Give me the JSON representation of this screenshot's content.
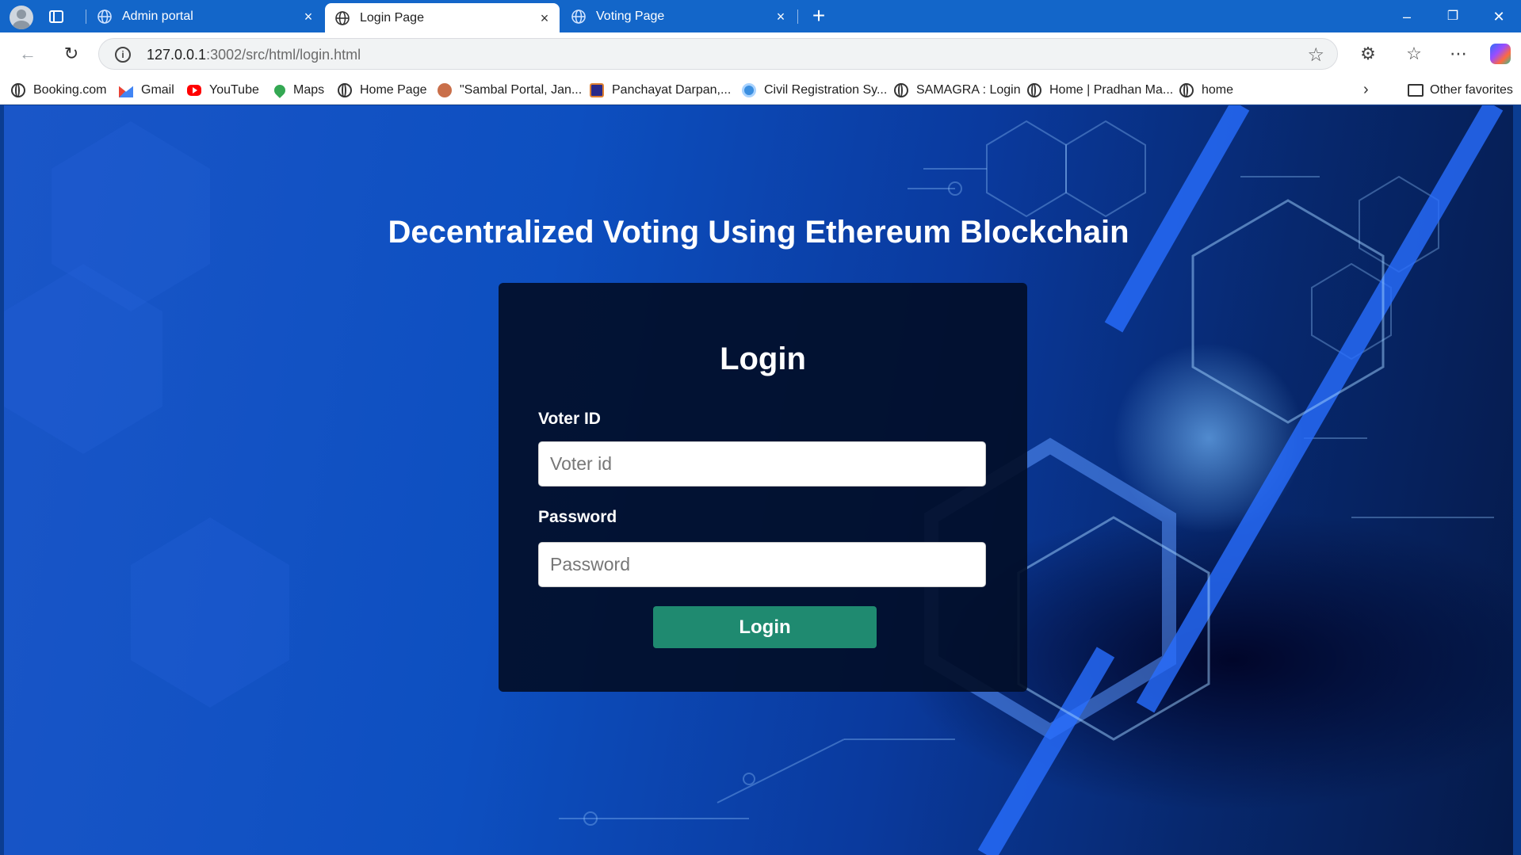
{
  "browser": {
    "tabs": [
      {
        "label": "Admin portal",
        "active": false
      },
      {
        "label": "Login Page",
        "active": true
      },
      {
        "label": "Voting Page",
        "active": false
      }
    ],
    "address": {
      "host": "127.0.0.1",
      "path": ":3002/src/html/login.html"
    },
    "favorites": [
      {
        "label": "Booking.com",
        "icon": "globe-icon"
      },
      {
        "label": "Gmail",
        "icon": "gmail-icon"
      },
      {
        "label": "YouTube",
        "icon": "youtube-icon"
      },
      {
        "label": "Maps",
        "icon": "maps-icon"
      },
      {
        "label": "Home Page",
        "icon": "globe-icon"
      },
      {
        "label": "\"Sambal Portal, Jan...",
        "icon": "sambal-icon"
      },
      {
        "label": "Panchayat Darpan,...",
        "icon": "panchayat-icon"
      },
      {
        "label": "Civil Registration Sy...",
        "icon": "civil-icon"
      },
      {
        "label": "SAMAGRA : Login",
        "icon": "globe-icon"
      },
      {
        "label": "Home | Pradhan Ma...",
        "icon": "globe-icon"
      },
      {
        "label": "home",
        "icon": "globe-icon"
      }
    ],
    "other_favorites": "Other favorites"
  },
  "page": {
    "title": "Decentralized Voting Using Ethereum Blockchain",
    "login": {
      "heading": "Login",
      "voter_label": "Voter ID",
      "voter_placeholder": "Voter id",
      "password_label": "Password",
      "password_placeholder": "Password",
      "button": "Login"
    }
  },
  "colors": {
    "tabstrip": "#1366c9",
    "card": "#020e28",
    "button": "#1f8a70"
  }
}
